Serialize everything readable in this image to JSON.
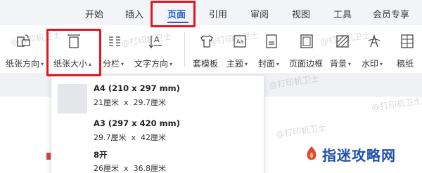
{
  "tabs": [
    {
      "label": "开始",
      "active": false
    },
    {
      "label": "插入",
      "active": false
    },
    {
      "label": "页面",
      "active": true
    },
    {
      "label": "引用",
      "active": false
    },
    {
      "label": "审阅",
      "active": false
    },
    {
      "label": "视图",
      "active": false
    },
    {
      "label": "工具",
      "active": false
    },
    {
      "label": "会员专享",
      "active": false
    }
  ],
  "ribbon": {
    "orientation": "纸张方向",
    "size": "纸张大小",
    "columns": "分栏",
    "text_direction": "文字方向",
    "template": "套模板",
    "theme": "主题",
    "cover": "封面",
    "page_border": "页面边框",
    "background": "背景",
    "watermark": "水印",
    "manuscript": "稿纸"
  },
  "paper_sizes": [
    {
      "name": "A4 (210 x 297 mm)",
      "width": "21厘米",
      "x": "x",
      "height": "29.7厘米"
    },
    {
      "name": "A3 (297 x 420 mm)",
      "width": "29.7厘米",
      "x": "x",
      "height": "42厘米"
    },
    {
      "name": "8开",
      "width": "26厘米",
      "x": "x",
      "height": "36.8厘米"
    }
  ],
  "watermark_text": "@打印机卫士",
  "brand": {
    "name": "指迷攻略网"
  },
  "colors": {
    "accent": "#1f5bd6",
    "highlight_box": "#e1171f",
    "brand": "#1f4fa8"
  }
}
